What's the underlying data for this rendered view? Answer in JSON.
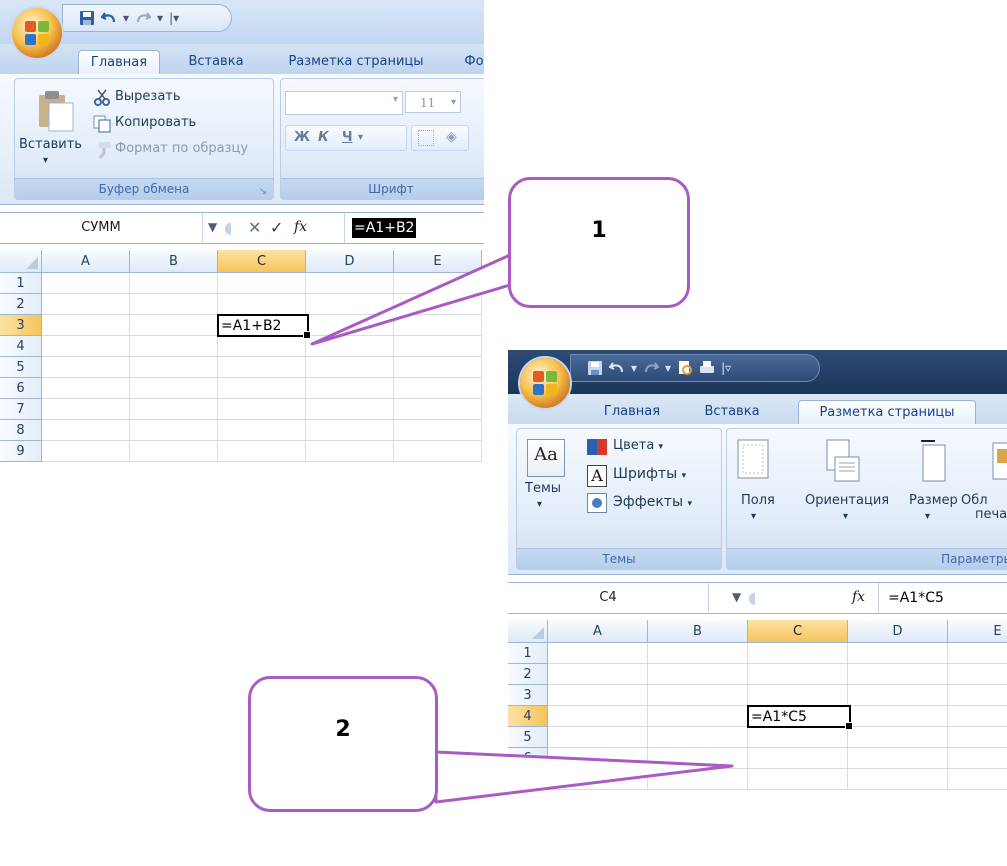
{
  "screenshot1": {
    "tabs": [
      "Главная",
      "Вставка",
      "Разметка страницы",
      "Фо"
    ],
    "clipboard": {
      "paste": "Вставить",
      "cut": "Вырезать",
      "copy": "Копировать",
      "format_painter": "Формат по образцу",
      "group_label": "Буфер обмена"
    },
    "font": {
      "size": "11",
      "bold": "Ж",
      "italic": "К",
      "underline": "Ч",
      "group_label": "Шрифт"
    },
    "formula_bar": {
      "name_box": "СУММ",
      "formula": "=A1+B2"
    },
    "columns": [
      "A",
      "B",
      "C",
      "D",
      "E"
    ],
    "rows": [
      "1",
      "2",
      "3",
      "4",
      "5",
      "6",
      "7",
      "8",
      "9"
    ],
    "active_cell_value": "=A1+B2"
  },
  "screenshot2": {
    "tabs": [
      "Главная",
      "Вставка",
      "Разметка страницы"
    ],
    "themes": {
      "themes": "Темы",
      "colors": "Цвета",
      "fonts": "Шрифты",
      "effects": "Эффекты",
      "group_label": "Темы",
      "icon_letter": "Aa",
      "font_letter": "A"
    },
    "page_setup": {
      "margins": "Поля",
      "orientation": "Ориентация",
      "size": "Размер",
      "print_area_1": "Обл",
      "print_area_2": "печа",
      "group_label": "Параметры"
    },
    "formula_bar": {
      "name_box": "C4",
      "formula": "=A1*C5"
    },
    "columns": [
      "A",
      "B",
      "C",
      "D",
      "E"
    ],
    "rows": [
      "1",
      "2",
      "3",
      "4",
      "5",
      "6",
      "7"
    ],
    "active_cell_value": "=A1*C5"
  },
  "callouts": [
    "1",
    "2"
  ],
  "fx_label": "fx",
  "colors": {
    "callout_border": "#a95bc1",
    "selected_header": "#f5c45a",
    "ribbon_text": "#15428b"
  }
}
